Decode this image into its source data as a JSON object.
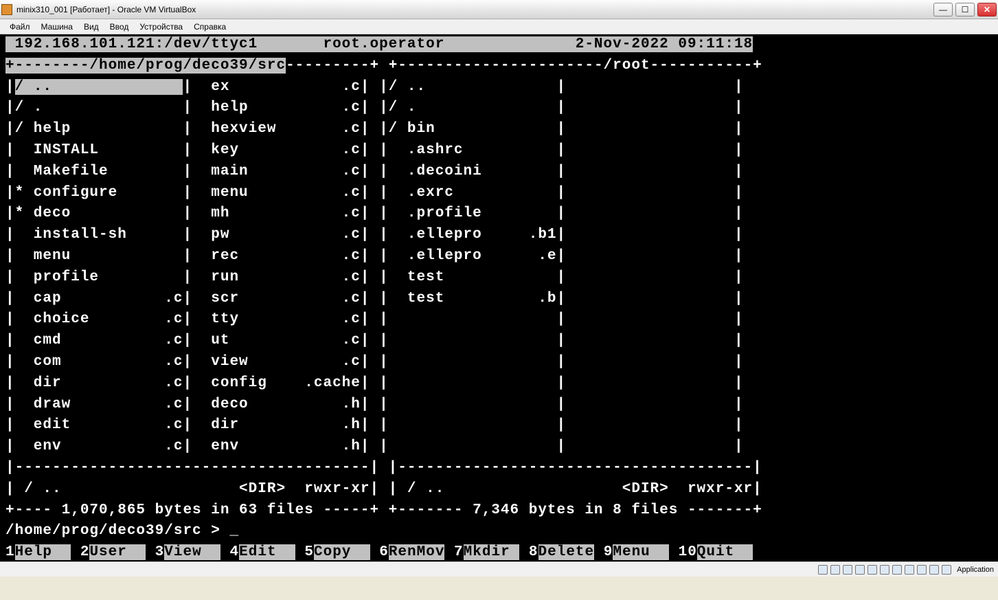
{
  "window": {
    "title": "minix310_001 [Работает] - Oracle VM VirtualBox"
  },
  "menu": {
    "items": [
      "Файл",
      "Машина",
      "Вид",
      "Ввод",
      "Устройства",
      "Справка"
    ]
  },
  "header": {
    "host": "192.168.101.121:/dev/ttyc1",
    "user": "root.operator",
    "datetime": "2-Nov-2022 09:11:18"
  },
  "left_panel": {
    "path": "/home/prog/deco39/src",
    "col1": [
      {
        "p": "/",
        "n": "..",
        "e": ""
      },
      {
        "p": "/",
        "n": ".",
        "e": ""
      },
      {
        "p": "/",
        "n": "help",
        "e": ""
      },
      {
        "p": " ",
        "n": "INSTALL",
        "e": ""
      },
      {
        "p": " ",
        "n": "Makefile",
        "e": ""
      },
      {
        "p": "*",
        "n": "configure",
        "e": ""
      },
      {
        "p": "*",
        "n": "deco",
        "e": ""
      },
      {
        "p": " ",
        "n": "install-sh",
        "e": ""
      },
      {
        "p": " ",
        "n": "menu",
        "e": ""
      },
      {
        "p": " ",
        "n": "profile",
        "e": ""
      },
      {
        "p": " ",
        "n": "cap",
        "e": ".c"
      },
      {
        "p": " ",
        "n": "choice",
        "e": ".c"
      },
      {
        "p": " ",
        "n": "cmd",
        "e": ".c"
      },
      {
        "p": " ",
        "n": "com",
        "e": ".c"
      },
      {
        "p": " ",
        "n": "dir",
        "e": ".c"
      },
      {
        "p": " ",
        "n": "draw",
        "e": ".c"
      },
      {
        "p": " ",
        "n": "edit",
        "e": ".c"
      },
      {
        "p": " ",
        "n": "env",
        "e": ".c"
      }
    ],
    "col2": [
      {
        "p": " ",
        "n": "ex",
        "e": ".c"
      },
      {
        "p": " ",
        "n": "help",
        "e": ".c"
      },
      {
        "p": " ",
        "n": "hexview",
        "e": ".c"
      },
      {
        "p": " ",
        "n": "key",
        "e": ".c"
      },
      {
        "p": " ",
        "n": "main",
        "e": ".c"
      },
      {
        "p": " ",
        "n": "menu",
        "e": ".c"
      },
      {
        "p": " ",
        "n": "mh",
        "e": ".c"
      },
      {
        "p": " ",
        "n": "pw",
        "e": ".c"
      },
      {
        "p": " ",
        "n": "rec",
        "e": ".c"
      },
      {
        "p": " ",
        "n": "run",
        "e": ".c"
      },
      {
        "p": " ",
        "n": "scr",
        "e": ".c"
      },
      {
        "p": " ",
        "n": "tty",
        "e": ".c"
      },
      {
        "p": " ",
        "n": "ut",
        "e": ".c"
      },
      {
        "p": " ",
        "n": "view",
        "e": ".c"
      },
      {
        "p": " ",
        "n": "config",
        "e": ".cache"
      },
      {
        "p": " ",
        "n": "deco",
        "e": ".h"
      },
      {
        "p": " ",
        "n": "dir",
        "e": ".h"
      },
      {
        "p": " ",
        "n": "env",
        "e": ".h"
      }
    ],
    "info": "/ ..                   <DIR>  rwxr-xr-x",
    "summary": "1,070,865 bytes in 63 files"
  },
  "right_panel": {
    "path": "/root",
    "col1": [
      {
        "p": "/",
        "n": "..",
        "e": ""
      },
      {
        "p": "/",
        "n": ".",
        "e": ""
      },
      {
        "p": "/",
        "n": "bin",
        "e": ""
      },
      {
        "p": " ",
        "n": ".ashrc",
        "e": ""
      },
      {
        "p": " ",
        "n": ".decoini",
        "e": ""
      },
      {
        "p": " ",
        "n": ".exrc",
        "e": ""
      },
      {
        "p": " ",
        "n": ".profile",
        "e": ""
      },
      {
        "p": " ",
        "n": ".ellepro",
        "e": ".b1"
      },
      {
        "p": " ",
        "n": ".ellepro",
        "e": ".e"
      },
      {
        "p": " ",
        "n": "test",
        "e": ""
      },
      {
        "p": " ",
        "n": "test",
        "e": ".b"
      }
    ],
    "info": "/ ..                   <DIR>  rwxr-xr-x",
    "summary": "7,346 bytes in 8 files"
  },
  "prompt": {
    "path": "/home/prog/deco39/src",
    "cursor": "> _"
  },
  "fkeys": [
    {
      "k": "1",
      "l": "Help  "
    },
    {
      "k": "2",
      "l": "User  "
    },
    {
      "k": "3",
      "l": "View  "
    },
    {
      "k": "4",
      "l": "Edit  "
    },
    {
      "k": "5",
      "l": "Copy  "
    },
    {
      "k": "6",
      "l": "RenMov"
    },
    {
      "k": "7",
      "l": "Mkdir "
    },
    {
      "k": "8",
      "l": "Delete"
    },
    {
      "k": "9",
      "l": "Menu  "
    },
    {
      "k": "10",
      "l": "Quit  "
    }
  ],
  "status": {
    "app": "Application"
  }
}
